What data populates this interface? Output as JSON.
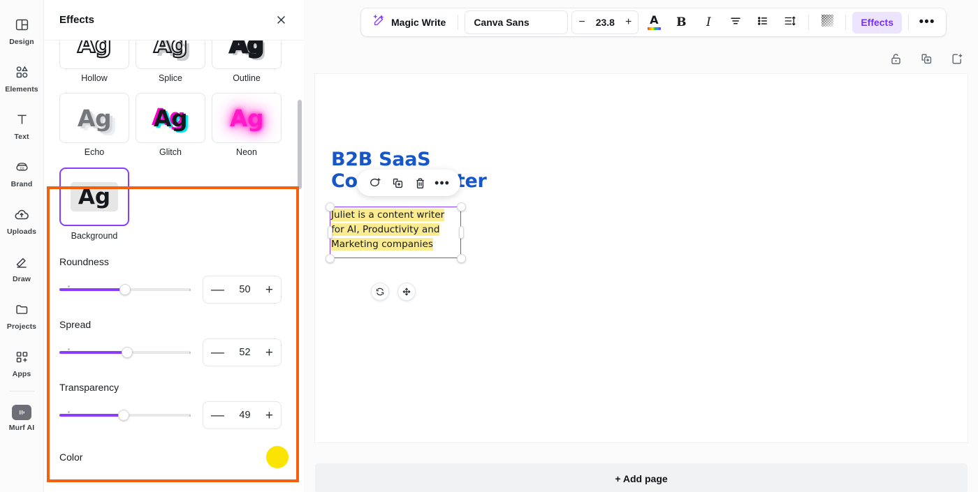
{
  "sidebar": {
    "items": [
      {
        "label": "Design",
        "icon": "design-icon"
      },
      {
        "label": "Elements",
        "icon": "elements-icon"
      },
      {
        "label": "Text",
        "icon": "text-icon"
      },
      {
        "label": "Brand",
        "icon": "brand-icon"
      },
      {
        "label": "Uploads",
        "icon": "uploads-icon"
      },
      {
        "label": "Draw",
        "icon": "draw-icon"
      },
      {
        "label": "Projects",
        "icon": "projects-icon"
      },
      {
        "label": "Apps",
        "icon": "apps-icon"
      }
    ],
    "pinned": {
      "label": "Murf AI",
      "icon": "murf-ai-icon"
    }
  },
  "panel": {
    "title": "Effects",
    "close_icon": "close-icon",
    "effects": [
      {
        "label": "Hollow",
        "style": "ag-hollow",
        "sample": "Ag"
      },
      {
        "label": "Splice",
        "style": "ag-splice",
        "sample": "Ag"
      },
      {
        "label": "Outline",
        "style": "ag-outline",
        "sample": "Ag"
      },
      {
        "label": "Echo",
        "style": "ag-echo",
        "sample": "Ag"
      },
      {
        "label": "Glitch",
        "style": "ag-glitch",
        "sample": "Ag"
      },
      {
        "label": "Neon",
        "style": "ag-neon",
        "sample": "Ag"
      }
    ],
    "selected_effect": {
      "label": "Background",
      "sample": "Ag",
      "accent": "#8b3dff"
    },
    "controls": [
      {
        "label": "Roundness",
        "value": "50",
        "percent": 50,
        "minus": "—",
        "plus": "+"
      },
      {
        "label": "Spread",
        "value": "52",
        "percent": 52,
        "minus": "—",
        "plus": "+"
      },
      {
        "label": "Transparency",
        "value": "49",
        "percent": 49,
        "minus": "—",
        "plus": "+"
      }
    ],
    "color": {
      "label": "Color",
      "swatch": "#fbe500"
    }
  },
  "annotation": {
    "color": "#f4600b"
  },
  "toolbar": {
    "magic_write": {
      "label": "Magic Write",
      "icon": "magic-wand-icon"
    },
    "font": {
      "value": "Canva Sans"
    },
    "font_size": {
      "value": "23.8",
      "minus": "−",
      "plus": "+"
    },
    "text_color_icon": "text-color-icon",
    "bold": {
      "label": "B",
      "icon": "bold-icon"
    },
    "italic": {
      "label": "I",
      "icon": "italic-icon"
    },
    "align_icon": "align-center-icon",
    "list_icon": "bullet-list-icon",
    "spacing_icon": "line-spacing-icon",
    "transparency_icon": "transparency-icon",
    "effects": {
      "label": "Effects",
      "active_bg": "#ede4ff",
      "active_fg": "#7533ef"
    },
    "more": {
      "label": "•••",
      "icon": "more-options-icon"
    }
  },
  "page_tools": [
    {
      "icon": "unlock-icon"
    },
    {
      "icon": "duplicate-page-icon"
    },
    {
      "icon": "add-page-icon"
    }
  ],
  "canvas": {
    "heading": "B2B SaaS Content Writer",
    "heading_color": "#1656c8",
    "element_toolbar": [
      {
        "icon": "comment-icon"
      },
      {
        "icon": "duplicate-icon"
      },
      {
        "icon": "trash-icon"
      },
      {
        "icon": "more-options-icon"
      }
    ],
    "selected_text": "Juliet is a content writer for AI, Productivity and Marketing companies",
    "highlight_color": "#fcec90",
    "selection_color": "#8b3dff",
    "move_tools": [
      {
        "icon": "rotate-icon"
      },
      {
        "icon": "move-icon"
      }
    ]
  },
  "footer": {
    "add_page": "+ Add page"
  }
}
